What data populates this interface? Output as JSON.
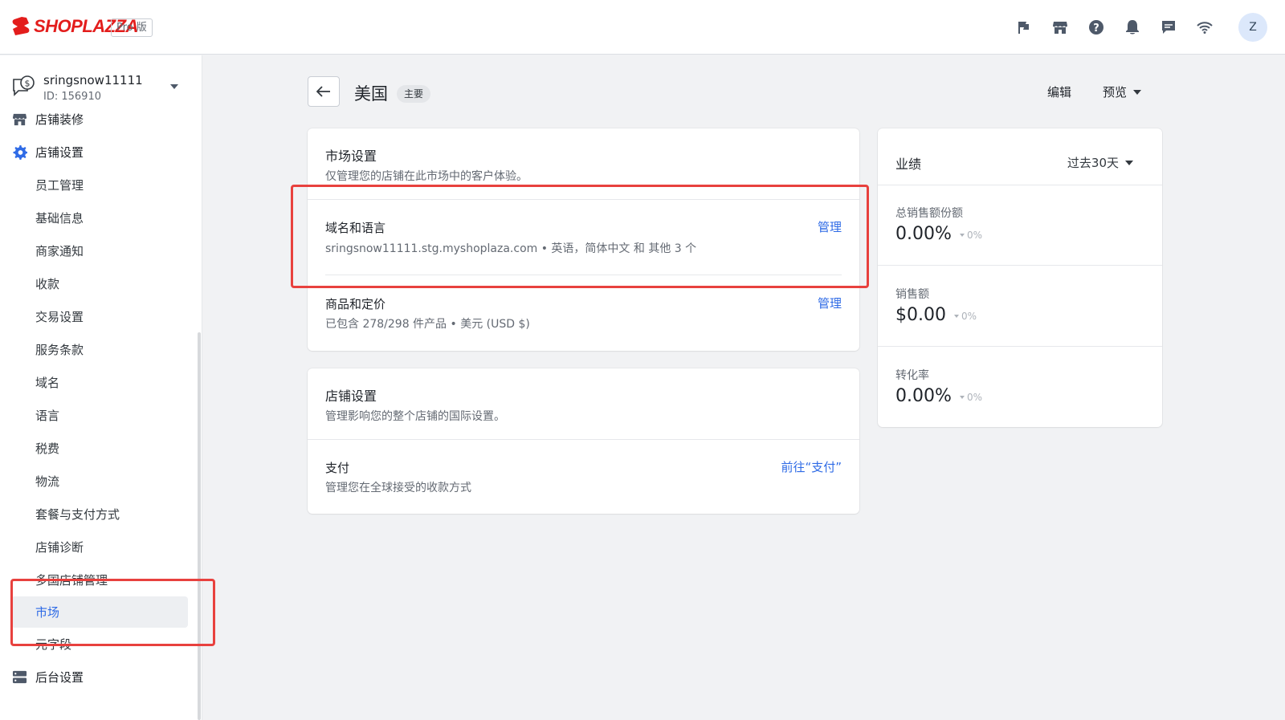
{
  "brand": {
    "logo_text": "SHOPLAZZA",
    "plan_badge": "Pro 版",
    "brand_color": "#e31d1c"
  },
  "header": {
    "icons": [
      "flag-icon",
      "storefront-icon",
      "help-icon",
      "bell-icon",
      "chat-icon",
      "wifi-icon"
    ],
    "avatar_letter": "Z"
  },
  "store": {
    "name": "sringsnow11111",
    "id": "ID: 156910"
  },
  "sidebar": {
    "items": [
      {
        "label": "店铺装修",
        "level": "top",
        "icon": "storefront-icon"
      },
      {
        "label": "店铺设置",
        "level": "top",
        "icon": "gear-icon"
      },
      {
        "label": "员工管理",
        "level": "sub"
      },
      {
        "label": "基础信息",
        "level": "sub"
      },
      {
        "label": "商家通知",
        "level": "sub"
      },
      {
        "label": "收款",
        "level": "sub"
      },
      {
        "label": "交易设置",
        "level": "sub"
      },
      {
        "label": "服务条款",
        "level": "sub"
      },
      {
        "label": "域名",
        "level": "sub"
      },
      {
        "label": "语言",
        "level": "sub"
      },
      {
        "label": "税费",
        "level": "sub"
      },
      {
        "label": "物流",
        "level": "sub"
      },
      {
        "label": "套餐与支付方式",
        "level": "sub"
      },
      {
        "label": "店铺诊断",
        "level": "sub"
      },
      {
        "label": "多国店铺管理",
        "level": "sub"
      },
      {
        "label": "市场",
        "level": "sub",
        "active": true
      },
      {
        "label": "元字段",
        "level": "sub"
      },
      {
        "label": "后台设置",
        "level": "top",
        "icon": "server-icon"
      }
    ],
    "accent": "#2f6be6"
  },
  "page": {
    "title": "美国",
    "badge": "主要",
    "edit_label": "编辑",
    "preview_label": "预览"
  },
  "market_card": {
    "title": "市场设置",
    "desc": "仅管理您的店铺在此市场中的客户体验。",
    "rows": [
      {
        "title": "域名和语言",
        "desc": "sringsnow11111.stg.myshoplaza.com • 英语，简体中文 和 其他 3 个",
        "link": "管理"
      },
      {
        "title": "商品和定价",
        "desc": "已包含 278/298 件产品 • 美元 (USD $)",
        "link": "管理"
      }
    ]
  },
  "store_card": {
    "title": "店铺设置",
    "desc": "管理影响您的整个店铺的国际设置。",
    "rows": [
      {
        "title": "支付",
        "desc": "管理您在全球接受的收款方式",
        "link": "前往“支付”"
      }
    ]
  },
  "performance": {
    "title": "业绩",
    "range": "过去30天",
    "metrics": [
      {
        "label": "总销售额份额",
        "value": "0.00%",
        "delta": "0%"
      },
      {
        "label": "销售额",
        "value": "$0.00",
        "delta": "0%"
      },
      {
        "label": "转化率",
        "value": "0.00%",
        "delta": "0%"
      }
    ]
  },
  "highlight_color": "#e8413e"
}
